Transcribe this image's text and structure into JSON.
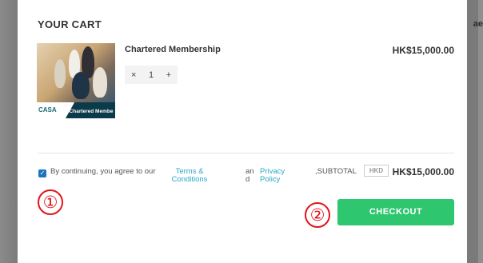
{
  "background": {
    "right_text": "ae"
  },
  "cart": {
    "title": "YOUR CART",
    "item": {
      "name": "Chartered Membership",
      "image_label": "Chartered Membe",
      "image_logo": "CASA",
      "quantity": "1",
      "minus": "×",
      "plus": "+",
      "price": "HK$15,000.00"
    }
  },
  "footer": {
    "agree_text": "By continuing, you agree to our",
    "checkbox_checked": true,
    "terms_link": "Terms & Conditions",
    "and_text": "and",
    "privacy_link": "Privacy Policy",
    "subtotal_label": ",SUBTOTAL",
    "currency": "HKD",
    "subtotal_value": "HK$15,000.00",
    "checkout_label": "CHECKOUT"
  },
  "annotations": {
    "one": "①",
    "two": "②"
  },
  "colors": {
    "accent_green": "#2ec66f",
    "link_blue": "#2aa7c8",
    "annotation_red": "#e0141b",
    "checkbox_blue": "#1e73be"
  }
}
